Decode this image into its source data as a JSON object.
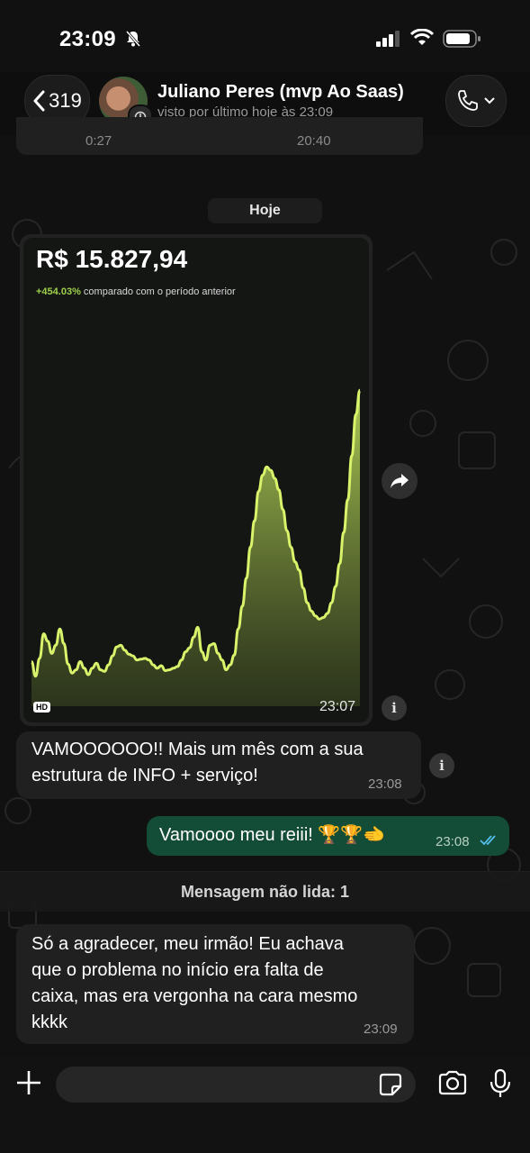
{
  "status_bar": {
    "time": "23:09"
  },
  "header": {
    "back_count": "319",
    "contact_name": "Juliano Peres (mvp Ao Saas)",
    "last_seen": "visto por último hoje às 23:09"
  },
  "partial_message": {
    "duration": "0:27",
    "time": "20:40"
  },
  "day_divider": "Hoje",
  "image_message": {
    "amount": "R$ 15.827,94",
    "percent": "+454.03%",
    "comparison": "comparado com o período anterior",
    "hd_label": "HD",
    "time": "23:07",
    "chart_data": {
      "type": "area",
      "series": [
        {
          "values": [
            38,
            20,
            42,
            72,
            63,
            48,
            58,
            78,
            60,
            35,
            24,
            28,
            38,
            30,
            22,
            30,
            36,
            28,
            26,
            34,
            45,
            56,
            58,
            52,
            47,
            45,
            40,
            41,
            42,
            40,
            34,
            30,
            33,
            27,
            28,
            30,
            32,
            40,
            50,
            55,
            68,
            80,
            50,
            40,
            58,
            60,
            48,
            40,
            28,
            34,
            46,
            78,
            106,
            140,
            178,
            210,
            246,
            266,
            276,
            272,
            262,
            248,
            224,
            198,
            178,
            160,
            150,
            128,
            110,
            100,
            94,
            90,
            92,
            97,
            110,
            130,
            158,
            196,
            236,
            290,
            340,
            370
          ]
        }
      ],
      "accent": "#d9f36b"
    }
  },
  "messages": [
    {
      "direction": "in",
      "text_line1": "VAMOOOOOO!! Mais um mês com a sua",
      "text_line2": "estrutura de INFO + serviço!",
      "time": "23:08"
    },
    {
      "direction": "out",
      "text": "Vamoooo meu reiii! 🏆🏆🫲",
      "time": "23:08"
    },
    {
      "direction": "in",
      "line1": "Só a agradecer, meu irmão! Eu achava",
      "line2": "que o problema no início era falta de",
      "line3": "caixa, mas era vergonha na cara mesmo",
      "line4": "kkkk",
      "time": "23:09"
    }
  ],
  "unread_divider": "Mensagem não lida: 1",
  "input": {
    "placeholder": ""
  },
  "icons": {
    "mute": "bell-slash-icon",
    "signal": "signal-bars-icon",
    "wifi": "wifi-icon",
    "battery": "battery-icon",
    "back": "chevron-left-icon",
    "call": "phone-icon",
    "forward": "forward-arrow-icon",
    "info": "info-icon",
    "read": "double-check-icon",
    "plus": "plus-icon",
    "sticker": "sticker-icon",
    "camera": "camera-icon",
    "mic": "microphone-icon"
  },
  "colors": {
    "bubble_in": "#202020",
    "bubble_out": "#144d37",
    "read_ticks": "#53bdeb",
    "chart_line": "#d9f36b",
    "percent_green": "#9fd04a"
  }
}
